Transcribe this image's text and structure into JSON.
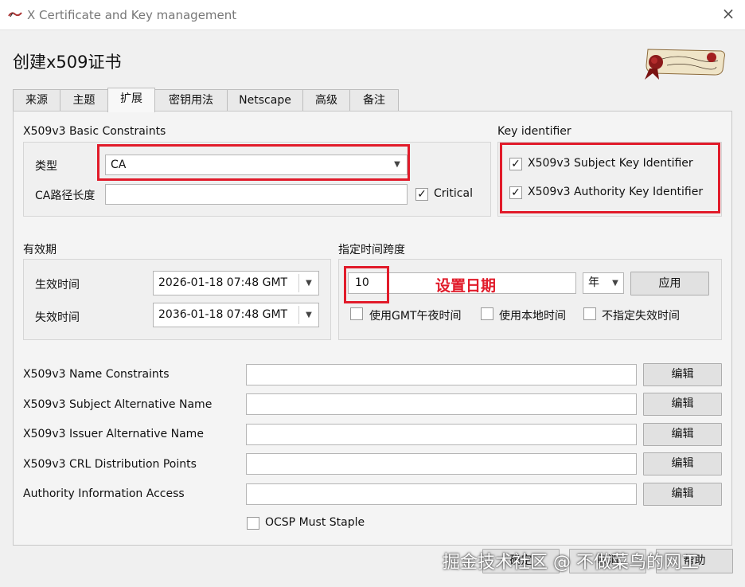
{
  "window": {
    "title": "X Certificate and Key management",
    "close": "×",
    "app_icon": "scroll-icon"
  },
  "dialog": {
    "title": "创建x509证书",
    "logo": "signature-scroll-logo"
  },
  "tabs": [
    {
      "label": "来源"
    },
    {
      "label": "主题"
    },
    {
      "label": "扩展",
      "active": true
    },
    {
      "label": "密钥用法"
    },
    {
      "label": "Netscape"
    },
    {
      "label": "高级"
    },
    {
      "label": "备注"
    }
  ],
  "basic_constraints": {
    "title": "X509v3 Basic Constraints",
    "type_label": "类型",
    "type_value": "CA",
    "path_len_label": "CA路径长度",
    "path_len_value": "",
    "critical_label": "Critical",
    "critical_checked": "✓"
  },
  "key_identifier": {
    "title": "Key identifier",
    "subject_label": "X509v3 Subject Key Identifier",
    "subject_checked": "✓",
    "authority_label": "X509v3 Authority Key Identifier",
    "authority_checked": "✓"
  },
  "validity": {
    "title": "有效期",
    "start_label": "生效时间",
    "start_value": "2026-01-18 07:48 GMT",
    "end_label": "失效时间",
    "end_value": "2036-01-18 07:48 GMT"
  },
  "time_range": {
    "title": "指定时间跨度",
    "amount": "10",
    "unit": "年",
    "apply_label": "应用",
    "midnight_label": "使用GMT午夜时间",
    "local_label": "使用本地时间",
    "no_expiry_label": "不指定失效时间"
  },
  "annotation": {
    "text": "设置日期"
  },
  "extensions": [
    {
      "label": "X509v3 Name Constraints",
      "value": "",
      "button": "编辑"
    },
    {
      "label": "X509v3 Subject Alternative Name",
      "value": "",
      "button": "编辑"
    },
    {
      "label": "X509v3 Issuer Alternative Name",
      "value": "",
      "button": "编辑"
    },
    {
      "label": "X509v3 CRL Distribution Points",
      "value": "",
      "button": "编辑"
    },
    {
      "label": "Authority Information Access",
      "value": "",
      "button": "编辑"
    }
  ],
  "ocsp_must_staple": {
    "label": "OCSP Must Staple"
  },
  "footer": {
    "ok_label": "确定",
    "cancel_label": "取消",
    "help_label": "帮助"
  },
  "watermark": "掘金技术社区 @ 不做菜鸟的网工",
  "colors": {
    "annotation_red": "#e11b2a",
    "logo_red": "#8b1a1a"
  }
}
